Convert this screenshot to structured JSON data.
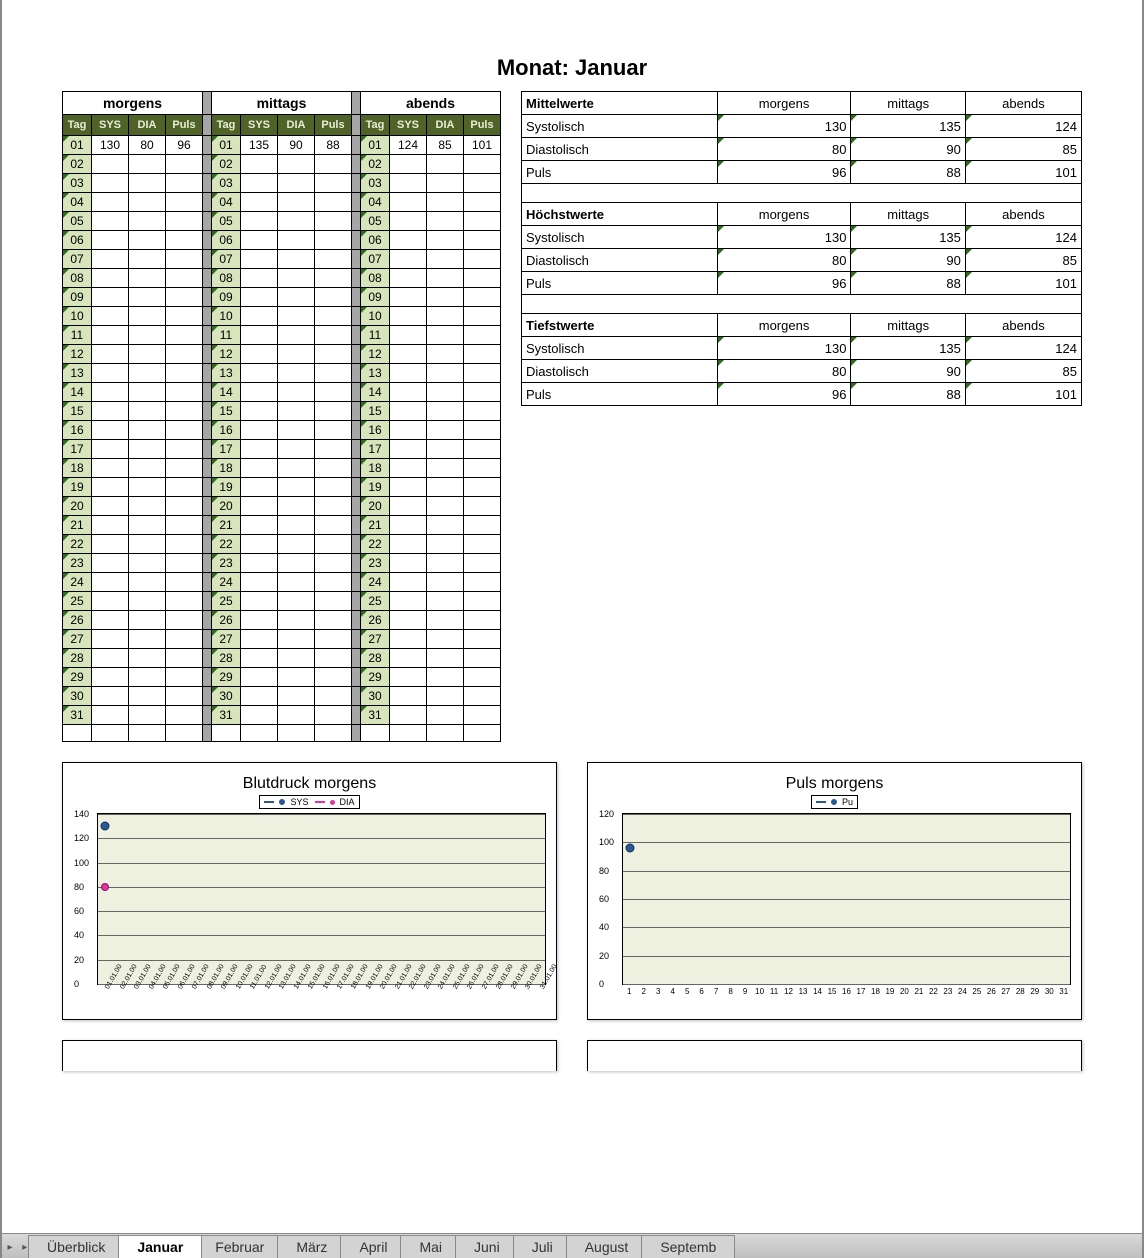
{
  "title": "Monat: Januar",
  "sections": {
    "morgens": "morgens",
    "mittags": "mittags",
    "abends": "abends"
  },
  "colheads": {
    "tag": "Tag",
    "sys": "SYS",
    "dia": "DIA",
    "puls": "Puls"
  },
  "days": [
    "01",
    "02",
    "03",
    "04",
    "05",
    "06",
    "07",
    "08",
    "09",
    "10",
    "11",
    "12",
    "13",
    "14",
    "15",
    "16",
    "17",
    "18",
    "19",
    "20",
    "21",
    "22",
    "23",
    "24",
    "25",
    "26",
    "27",
    "28",
    "29",
    "30",
    "31"
  ],
  "entries": {
    "morgens": {
      "01": {
        "sys": 130,
        "dia": 80,
        "puls": 96
      }
    },
    "mittags": {
      "01": {
        "sys": 135,
        "dia": 90,
        "puls": 88
      }
    },
    "abends": {
      "01": {
        "sys": 124,
        "dia": 85,
        "puls": 101
      }
    }
  },
  "stats_groups": [
    {
      "title": "Mittelwerte",
      "heads": [
        "morgens",
        "mittags",
        "abends"
      ],
      "rows": [
        {
          "label": "Systolisch",
          "vals": [
            130,
            135,
            124
          ]
        },
        {
          "label": "Diastolisch",
          "vals": [
            80,
            90,
            85
          ]
        },
        {
          "label": "Puls",
          "vals": [
            96,
            88,
            101
          ]
        }
      ]
    },
    {
      "title": "Höchstwerte",
      "heads": [
        "morgens",
        "mittags",
        "abends"
      ],
      "rows": [
        {
          "label": "Systolisch",
          "vals": [
            130,
            135,
            124
          ]
        },
        {
          "label": "Diastolisch",
          "vals": [
            80,
            90,
            85
          ]
        },
        {
          "label": "Puls",
          "vals": [
            96,
            88,
            101
          ]
        }
      ]
    },
    {
      "title": "Tiefstwerte",
      "heads": [
        "morgens",
        "mittags",
        "abends"
      ],
      "rows": [
        {
          "label": "Systolisch",
          "vals": [
            130,
            135,
            124
          ]
        },
        {
          "label": "Diastolisch",
          "vals": [
            80,
            90,
            85
          ]
        },
        {
          "label": "Puls",
          "vals": [
            96,
            88,
            101
          ]
        }
      ]
    }
  ],
  "charts": {
    "bp": {
      "title": "Blutdruck morgens",
      "legend": [
        "SYS",
        "DIA"
      ],
      "yticks": [
        0,
        20,
        40,
        60,
        80,
        100,
        120,
        140
      ],
      "xlabels": [
        "01.01.00",
        "02.01.00",
        "03.01.00",
        "04.01.00",
        "05.01.00",
        "06.01.00",
        "07.01.00",
        "08.01.00",
        "09.01.00",
        "10.01.00",
        "11.01.00",
        "12.01.00",
        "13.01.00",
        "14.01.00",
        "15.01.00",
        "16.01.00",
        "17.01.00",
        "18.01.00",
        "19.01.00",
        "20.01.00",
        "21.01.00",
        "22.01.00",
        "23.01.00",
        "24.01.00",
        "25.01.00",
        "26.01.00",
        "27.01.00",
        "28.01.00",
        "29.01.00",
        "30.01.00",
        "31.01.00"
      ]
    },
    "pulse": {
      "title": "Puls morgens",
      "legend": [
        "Pu"
      ],
      "yticks": [
        0,
        20,
        40,
        60,
        80,
        100,
        120
      ],
      "xlabels": [
        "1",
        "2",
        "3",
        "4",
        "5",
        "6",
        "7",
        "8",
        "9",
        "10",
        "11",
        "12",
        "13",
        "14",
        "15",
        "16",
        "17",
        "18",
        "19",
        "20",
        "21",
        "22",
        "23",
        "24",
        "25",
        "26",
        "27",
        "28",
        "29",
        "30",
        "31"
      ]
    }
  },
  "chart_data": [
    {
      "type": "line",
      "title": "Blutdruck morgens",
      "xlabel": "",
      "ylabel": "",
      "ylim": [
        0,
        140
      ],
      "x": [
        "01.01.00",
        "02.01.00",
        "03.01.00",
        "04.01.00",
        "05.01.00",
        "06.01.00",
        "07.01.00",
        "08.01.00",
        "09.01.00",
        "10.01.00",
        "11.01.00",
        "12.01.00",
        "13.01.00",
        "14.01.00",
        "15.01.00",
        "16.01.00",
        "17.01.00",
        "18.01.00",
        "19.01.00",
        "20.01.00",
        "21.01.00",
        "22.01.00",
        "23.01.00",
        "24.01.00",
        "25.01.00",
        "26.01.00",
        "27.01.00",
        "28.01.00",
        "29.01.00",
        "30.01.00",
        "31.01.00"
      ],
      "series": [
        {
          "name": "SYS",
          "values": [
            130,
            null,
            null,
            null,
            null,
            null,
            null,
            null,
            null,
            null,
            null,
            null,
            null,
            null,
            null,
            null,
            null,
            null,
            null,
            null,
            null,
            null,
            null,
            null,
            null,
            null,
            null,
            null,
            null,
            null,
            null
          ]
        },
        {
          "name": "DIA",
          "values": [
            80,
            null,
            null,
            null,
            null,
            null,
            null,
            null,
            null,
            null,
            null,
            null,
            null,
            null,
            null,
            null,
            null,
            null,
            null,
            null,
            null,
            null,
            null,
            null,
            null,
            null,
            null,
            null,
            null,
            null,
            null
          ]
        }
      ]
    },
    {
      "type": "line",
      "title": "Puls morgens",
      "xlabel": "",
      "ylabel": "",
      "ylim": [
        0,
        120
      ],
      "x": [
        1,
        2,
        3,
        4,
        5,
        6,
        7,
        8,
        9,
        10,
        11,
        12,
        13,
        14,
        15,
        16,
        17,
        18,
        19,
        20,
        21,
        22,
        23,
        24,
        25,
        26,
        27,
        28,
        29,
        30,
        31
      ],
      "series": [
        {
          "name": "Pu",
          "values": [
            96,
            null,
            null,
            null,
            null,
            null,
            null,
            null,
            null,
            null,
            null,
            null,
            null,
            null,
            null,
            null,
            null,
            null,
            null,
            null,
            null,
            null,
            null,
            null,
            null,
            null,
            null,
            null,
            null,
            null,
            null
          ]
        }
      ]
    }
  ],
  "tabs": [
    "Überblick",
    "Januar",
    "Februar",
    "März",
    "April",
    "Mai",
    "Juni",
    "Juli",
    "August",
    "Septemb"
  ],
  "active_tab": "Januar"
}
